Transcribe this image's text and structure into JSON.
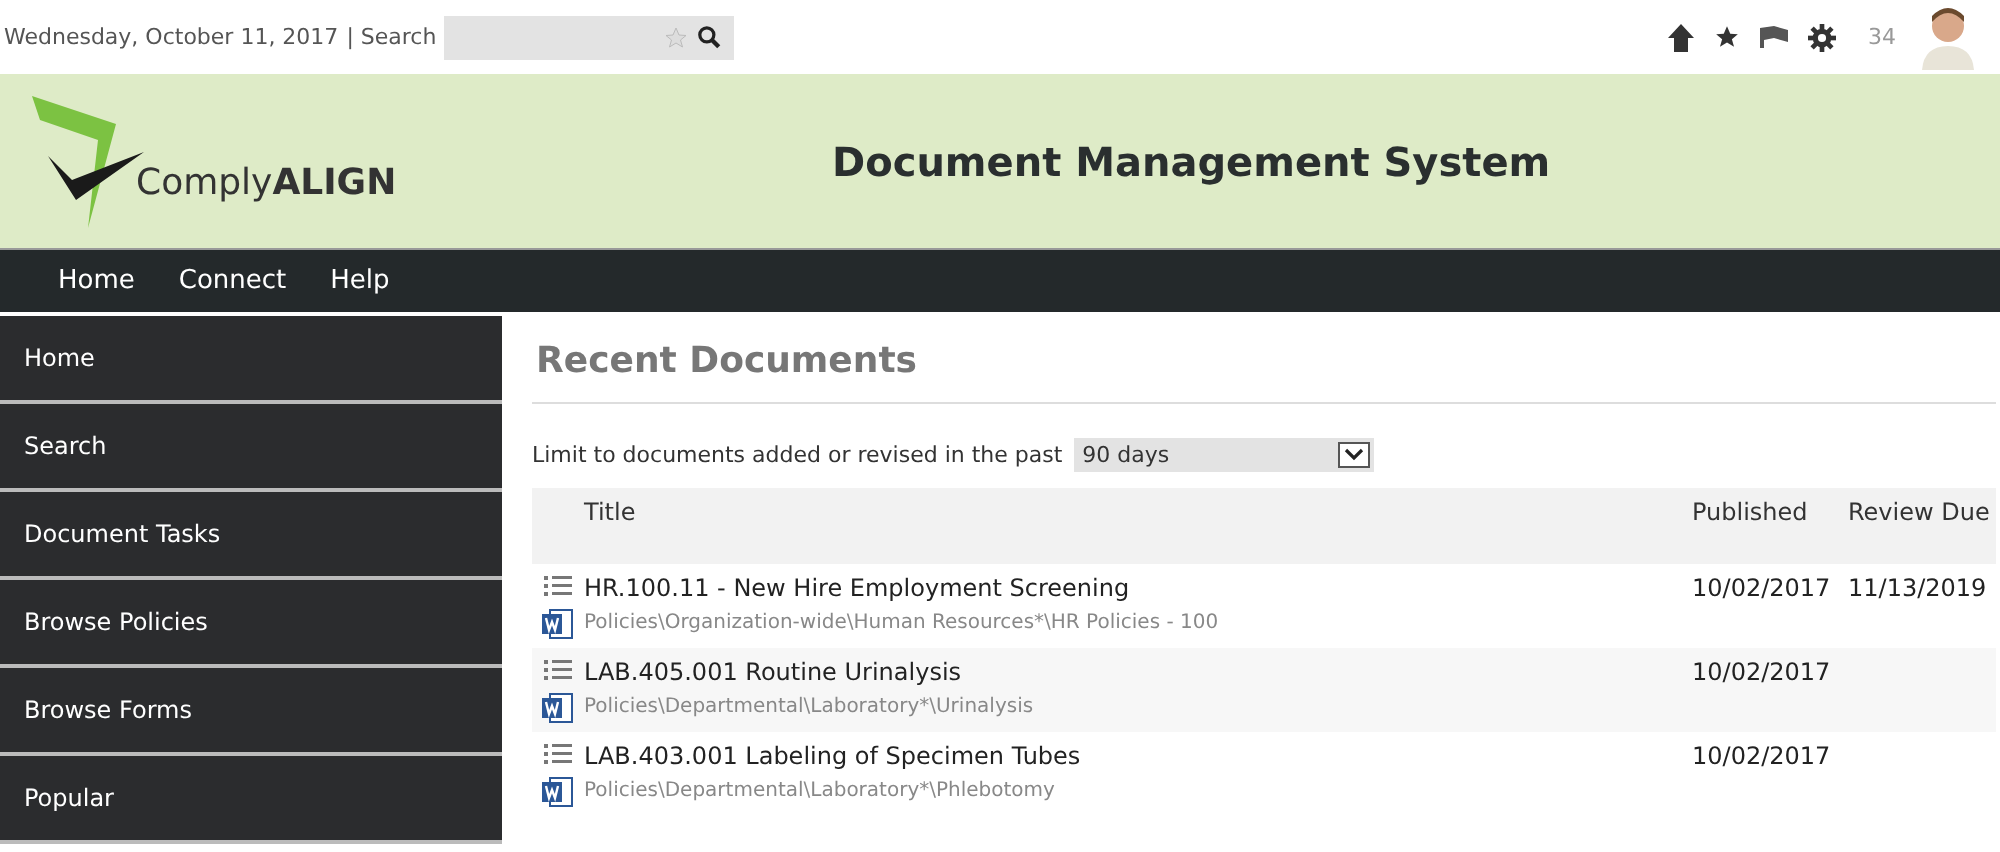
{
  "topbar": {
    "date": "Wednesday, October 11, 2017",
    "search_label": "| Search",
    "notification_count": "34"
  },
  "header": {
    "logo_light": "Comply",
    "logo_bold": "ALIGN",
    "title": "Document Management System"
  },
  "nav": [
    "Home",
    "Connect",
    "Help"
  ],
  "sidebar": {
    "items": [
      {
        "label": "Home"
      },
      {
        "label": "Search"
      },
      {
        "label": "Document Tasks"
      },
      {
        "label": "Browse Policies"
      },
      {
        "label": "Browse Forms"
      },
      {
        "label": "Popular"
      }
    ]
  },
  "content": {
    "heading": "Recent Documents",
    "filter_label": "Limit to documents added or revised in the past",
    "filter_value": "90 days",
    "table": {
      "columns": [
        "Title",
        "Published",
        "Review Due"
      ],
      "rows": [
        {
          "title": "HR.100.11 - New Hire Employment Screening",
          "path": "Policies\\Organization-wide\\Human Resources*\\HR Policies - 100",
          "published": "10/02/2017",
          "review_due": "11/13/2019"
        },
        {
          "title": "LAB.405.001 Routine Urinalysis",
          "path": "Policies\\Departmental\\Laboratory*\\Urinalysis",
          "published": "10/02/2017"
        },
        {
          "title": "LAB.403.001 Labeling of Specimen Tubes",
          "path": "Policies\\Departmental\\Laboratory*\\Phlebotomy",
          "published": "10/02/2017"
        }
      ]
    }
  }
}
